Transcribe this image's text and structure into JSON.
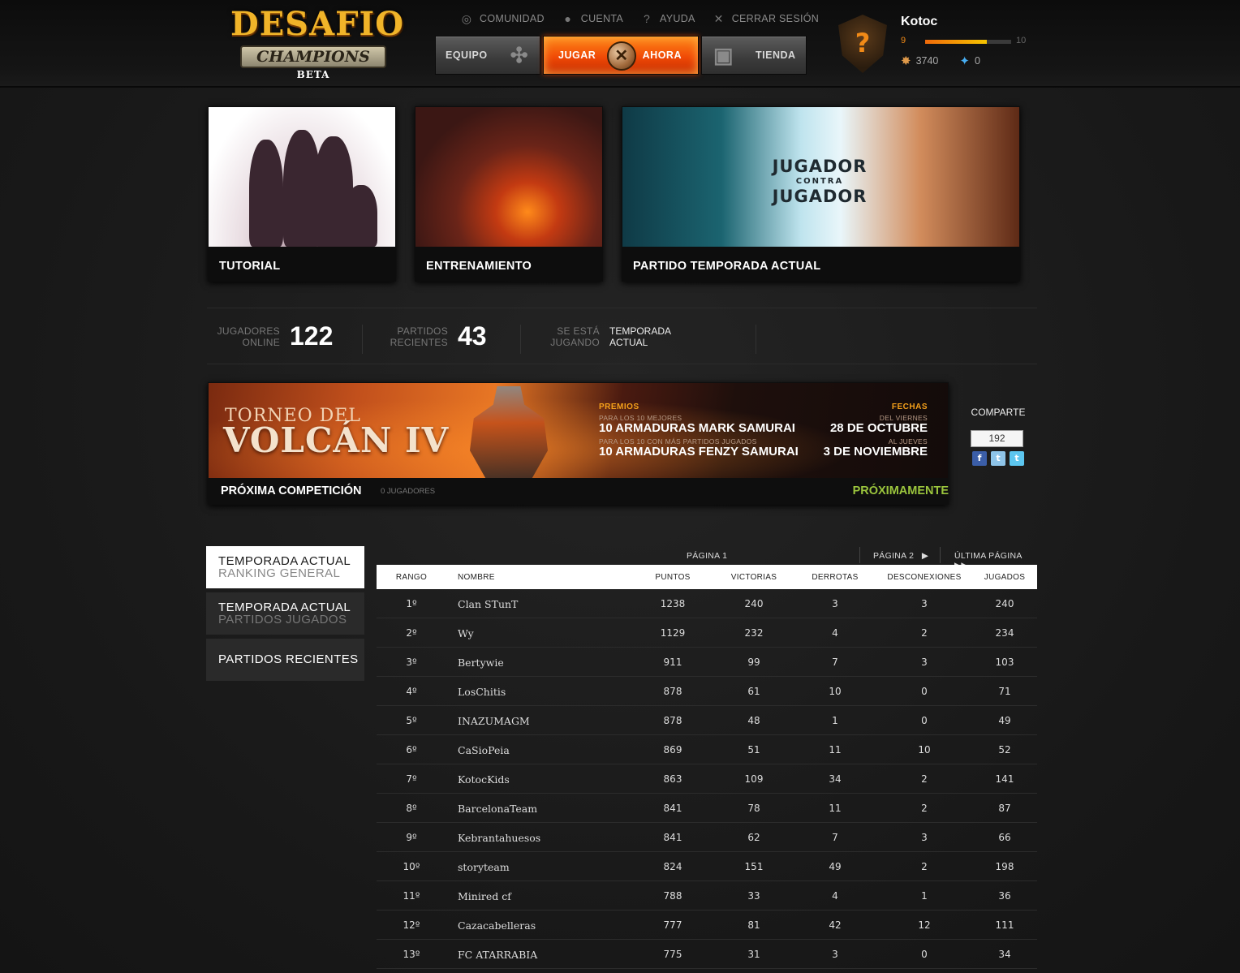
{
  "header": {
    "logo": {
      "title": "DESAFIO",
      "subtitle": "CHAMPIONS",
      "tag": "BETA"
    },
    "topnav": [
      {
        "label": "COMUNIDAD",
        "icon": "community-icon"
      },
      {
        "label": "CUENTA",
        "icon": "user-icon"
      },
      {
        "label": "AYUDA",
        "icon": "help-icon"
      },
      {
        "label": "CERRAR SESIÓN",
        "icon": "close-icon"
      }
    ],
    "buttons": {
      "equipo": "EQUIPO",
      "jugar": "JUGAR",
      "ahora": "AHORA",
      "tienda": "TIENDA"
    },
    "profile": {
      "name": "Kotoc",
      "level": "9",
      "next_level": "10",
      "level_progress": 0.72,
      "coins": "3740",
      "gems": "0"
    }
  },
  "modes": [
    {
      "caption": "TUTORIAL"
    },
    {
      "caption": "ENTRENAMIENTO"
    },
    {
      "caption": "PARTIDO TEMPORADA ACTUAL",
      "art_title_1": "JUGADOR",
      "art_title_2": "CONTRA",
      "art_title_3": "JUGADOR"
    }
  ],
  "stats": {
    "online_label_1": "JUGADORES",
    "online_label_2": "ONLINE",
    "online_value": "122",
    "recent_label_1": "PARTIDOS",
    "recent_label_2": "RECIENTES",
    "recent_value": "43",
    "playing_label_1": "SE ESTÁ",
    "playing_label_2": "JUGANDO",
    "playing_value": "TEMPORADA ACTUAL"
  },
  "tournament": {
    "title_small": "TORNEO DEL",
    "title_big": "VOLCÁN IV",
    "prizes_label": "PREMIOS",
    "prize1_sub": "PARA LOS 10 MEJORES",
    "prize1": "10 ARMADURAS MARK SAMURAI",
    "prize2_sub": "PARA LOS 10 CON MÁS PARTIDOS JUGADOS",
    "prize2": "10 ARMADURAS FENZY SAMURAI",
    "dates_label": "FECHAS",
    "date1_sub": "DEL VIERNES",
    "date1": "28 DE OCTUBRE",
    "date2_sub": "AL JUEVES",
    "date2": "3 DE  NOVIEMBRE",
    "next_label": "PRÓXIMA COMPETICIÓN",
    "players": "0 JUGADORES",
    "status": "PRÓXIMAMENTE"
  },
  "share": {
    "label": "COMPARTE",
    "count": "192"
  },
  "ranking_tabs": [
    {
      "line1": "TEMPORADA ACTUAL",
      "line2": "RANKING GENERAL"
    },
    {
      "line1": "TEMPORADA ACTUAL",
      "line2": "PARTIDOS JUGADOS"
    },
    {
      "line1": "PARTIDOS RECIENTES"
    }
  ],
  "pager": {
    "current": "PÁGINA  1",
    "next": "PÁGINA  2",
    "last": "ÚLTIMA PÁGINA"
  },
  "table": {
    "columns": [
      "RANGO",
      "NOMBRE",
      "PUNTOS",
      "VICTORIAS",
      "DERROTAS",
      "DESCONEXIONES",
      "JUGADOS"
    ],
    "rows": [
      [
        "1º",
        "Clan STunT",
        "1238",
        "240",
        "3",
        "3",
        "240"
      ],
      [
        "2º",
        "Wy",
        "1129",
        "232",
        "4",
        "2",
        "234"
      ],
      [
        "3º",
        "Bertywie",
        "911",
        "99",
        "7",
        "3",
        "103"
      ],
      [
        "4º",
        "LosChitis",
        "878",
        "61",
        "10",
        "0",
        "71"
      ],
      [
        "5º",
        "INAZUMAGM",
        "878",
        "48",
        "1",
        "0",
        "49"
      ],
      [
        "6º",
        "CaSioPeia",
        "869",
        "51",
        "11",
        "10",
        "52"
      ],
      [
        "7º",
        "KotocKids",
        "863",
        "109",
        "34",
        "2",
        "141"
      ],
      [
        "8º",
        "BarcelonaTeam",
        "841",
        "78",
        "11",
        "2",
        "87"
      ],
      [
        "9º",
        "Kebrantahuesos",
        "841",
        "62",
        "7",
        "3",
        "66"
      ],
      [
        "10º",
        "storyteam",
        "824",
        "151",
        "49",
        "2",
        "198"
      ],
      [
        "11º",
        "Minired cf",
        "788",
        "33",
        "4",
        "1",
        "36"
      ],
      [
        "12º",
        "Cazacabelleras",
        "777",
        "81",
        "42",
        "12",
        "111"
      ],
      [
        "13º",
        "FC ATARRABIA",
        "775",
        "31",
        "3",
        "0",
        "34"
      ]
    ]
  }
}
